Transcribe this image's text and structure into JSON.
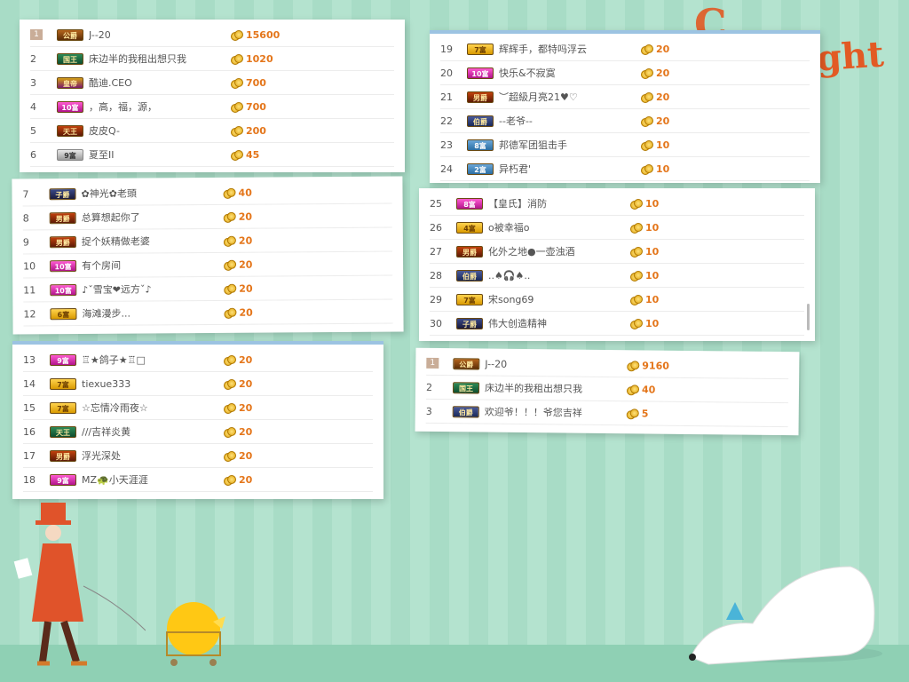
{
  "panel_a": [
    {
      "rank": "1",
      "badge": "公爵",
      "badge_class": "b-gong",
      "name": "J--20",
      "value": "15600",
      "first": true
    },
    {
      "rank": "2",
      "badge": "国王",
      "badge_class": "b-wang",
      "name": "床边半的我租出想只我",
      "value": "1020"
    },
    {
      "rank": "3",
      "badge": "皇帝",
      "badge_class": "b-huang",
      "name": "酷迪.CEO",
      "value": "700"
    },
    {
      "rank": "4",
      "badge": "10富",
      "badge_class": "b-fu",
      "name": "，高，福，源，",
      "value": "700"
    },
    {
      "rank": "5",
      "badge": "天王",
      "badge_class": "b-nan",
      "name": "皮皮Q-",
      "value": "200"
    },
    {
      "rank": "6",
      "badge": "9富",
      "badge_class": "b-yin",
      "name": "夏至II",
      "value": "45"
    }
  ],
  "panel_b": [
    {
      "rank": "7",
      "badge": "子爵",
      "badge_class": "b-zi",
      "name": "✿神光✿老頭",
      "value": "40"
    },
    {
      "rank": "8",
      "badge": "男爵",
      "badge_class": "b-nan",
      "name": "总算想起你了",
      "value": "20"
    },
    {
      "rank": "9",
      "badge": "男爵",
      "badge_class": "b-nan",
      "name": "捉个妖精做老婆",
      "value": "20"
    },
    {
      "rank": "10",
      "badge": "10富",
      "badge_class": "b-fu",
      "name": "有个房间",
      "value": "20"
    },
    {
      "rank": "11",
      "badge": "10富",
      "badge_class": "b-fu",
      "name": "♪ˇ雪宝❤远方ˇ♪",
      "value": "20"
    },
    {
      "rank": "12",
      "badge": "6富",
      "badge_class": "b-gold",
      "name": "海滩漫步...",
      "value": "20"
    }
  ],
  "panel_c": [
    {
      "rank": "13",
      "badge": "9富",
      "badge_class": "b-fu",
      "name": "♖★鸽子★♖□",
      "value": "20"
    },
    {
      "rank": "14",
      "badge": "7富",
      "badge_class": "b-gold",
      "name": "tiexue333",
      "value": "20"
    },
    {
      "rank": "15",
      "badge": "7富",
      "badge_class": "b-gold",
      "name": "☆忘情冷雨夜☆",
      "value": "20"
    },
    {
      "rank": "16",
      "badge": "天王",
      "badge_class": "b-wang",
      "name": "///吉祥炎黄",
      "value": "20"
    },
    {
      "rank": "17",
      "badge": "男爵",
      "badge_class": "b-nan",
      "name": "浮光深处",
      "value": "20"
    },
    {
      "rank": "18",
      "badge": "9富",
      "badge_class": "b-fu",
      "name": "MZ🐢小天涯涯",
      "value": "20"
    }
  ],
  "panel_d": [
    {
      "rank": "19",
      "badge": "7富",
      "badge_class": "b-gold",
      "name": "辉辉手，都特吗浮云",
      "value": "20"
    },
    {
      "rank": "20",
      "badge": "10富",
      "badge_class": "b-fu",
      "name": "快乐&不寂寞",
      "value": "20"
    },
    {
      "rank": "21",
      "badge": "男爵",
      "badge_class": "b-nan",
      "name": "︶超級月亮21♥♡",
      "value": "20"
    },
    {
      "rank": "22",
      "badge": "伯爵",
      "badge_class": "b-bo",
      "name": "--老爷--",
      "value": "20"
    },
    {
      "rank": "23",
      "badge": "8富",
      "badge_class": "b-blue",
      "name": "邦德军团狙击手",
      "value": "10"
    },
    {
      "rank": "24",
      "badge": "2富",
      "badge_class": "b-blue",
      "name": "异朽君'",
      "value": "10"
    }
  ],
  "panel_e": [
    {
      "rank": "25",
      "badge": "8富",
      "badge_class": "b-fu",
      "name": "【皇氏】消防",
      "value": "10"
    },
    {
      "rank": "26",
      "badge": "4富",
      "badge_class": "b-gold",
      "name": "o被幸福o",
      "value": "10"
    },
    {
      "rank": "27",
      "badge": "男爵",
      "badge_class": "b-nan",
      "name": "化外之地●一壶浊酒",
      "value": "10"
    },
    {
      "rank": "28",
      "badge": "伯爵",
      "badge_class": "b-bo",
      "name": "..♠🎧♠..",
      "value": "10"
    },
    {
      "rank": "29",
      "badge": "7富",
      "badge_class": "b-gold",
      "name": "宋song69",
      "value": "10"
    },
    {
      "rank": "30",
      "badge": "子爵",
      "badge_class": "b-zi",
      "name": "伟大创造精神",
      "value": "10"
    }
  ],
  "panel_f": [
    {
      "rank": "1",
      "badge": "公爵",
      "badge_class": "b-gong",
      "name": "J--20",
      "value": "9160",
      "first": true
    },
    {
      "rank": "2",
      "badge": "国王",
      "badge_class": "b-wang",
      "name": "床边半的我租出想只我",
      "value": "40"
    },
    {
      "rank": "3",
      "badge": "伯爵",
      "badge_class": "b-bo",
      "name": "欢迎爷！！！爷您吉祥",
      "value": "5"
    }
  ],
  "decor": {
    "top_right_text": "ght",
    "top_right_letter": "C"
  }
}
